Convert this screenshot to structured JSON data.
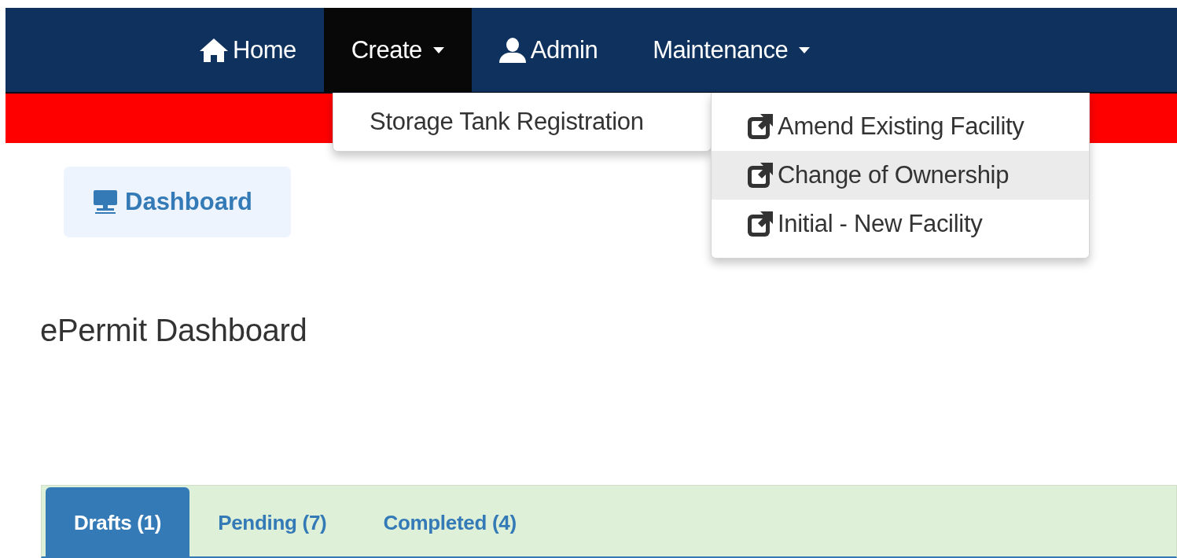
{
  "navbar": {
    "items": [
      {
        "label": "Home",
        "kind": "link",
        "selected": false
      },
      {
        "label": "Create",
        "kind": "dropdown",
        "selected": true
      },
      {
        "label": "Admin",
        "kind": "link",
        "selected": false
      },
      {
        "label": "Maintenance",
        "kind": "dropdown",
        "selected": false
      }
    ]
  },
  "create_menu": {
    "items": [
      {
        "label": "Storage Tank Registration",
        "selected": false
      }
    ]
  },
  "maintenance_menu": {
    "items": [
      {
        "label": "Amend Existing Facility",
        "selected": false
      },
      {
        "label": "Change of Ownership",
        "selected": true
      },
      {
        "label": "Initial - New Facility",
        "selected": false
      }
    ]
  },
  "dashboard_button": {
    "label": "Dashboard"
  },
  "heading": "ePermit Dashboard",
  "tabs": [
    {
      "label": "Drafts (1)",
      "selected": true
    },
    {
      "label": "Pending (7)",
      "selected": false
    },
    {
      "label": "Completed (4)",
      "selected": false
    }
  ]
}
